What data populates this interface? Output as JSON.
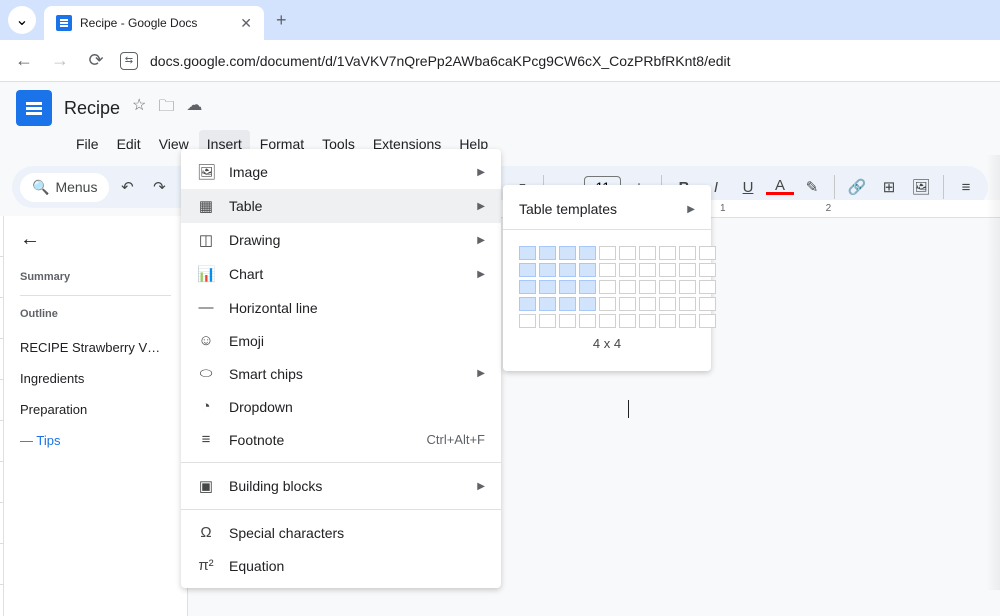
{
  "browser": {
    "tab_title": "Recipe - Google Docs",
    "url": "docs.google.com/document/d/1VaVKV7nQrePp2AWba6caKPcg9CW6cX_CozPRbfRKnt8/edit"
  },
  "doc": {
    "title": "Recipe",
    "font": "Lato",
    "font_size": "11"
  },
  "menubar": [
    "File",
    "Edit",
    "View",
    "Insert",
    "Format",
    "Tools",
    "Extensions",
    "Help"
  ],
  "toolbar": {
    "menus_label": "Menus"
  },
  "insert_menu": {
    "image": "Image",
    "table": "Table",
    "drawing": "Drawing",
    "chart": "Chart",
    "hr": "Horizontal line",
    "emoji": "Emoji",
    "smart_chips": "Smart chips",
    "dropdown": "Dropdown",
    "footnote": "Footnote",
    "footnote_shortcut": "Ctrl+Alt+F",
    "building_blocks": "Building blocks",
    "special_chars": "Special characters",
    "equation": "Equation"
  },
  "table_submenu": {
    "templates": "Table templates",
    "grid_label": "4 x 4",
    "selected_rows": 4,
    "selected_cols": 4
  },
  "sidebar": {
    "summary": "Summary",
    "outline": "Outline",
    "items": [
      "RECIPE Strawberry V…",
      "Ingredients",
      "Preparation",
      "Tips"
    ],
    "active_index": 3
  },
  "ruler": {
    "m1": "1",
    "m2": "2"
  }
}
